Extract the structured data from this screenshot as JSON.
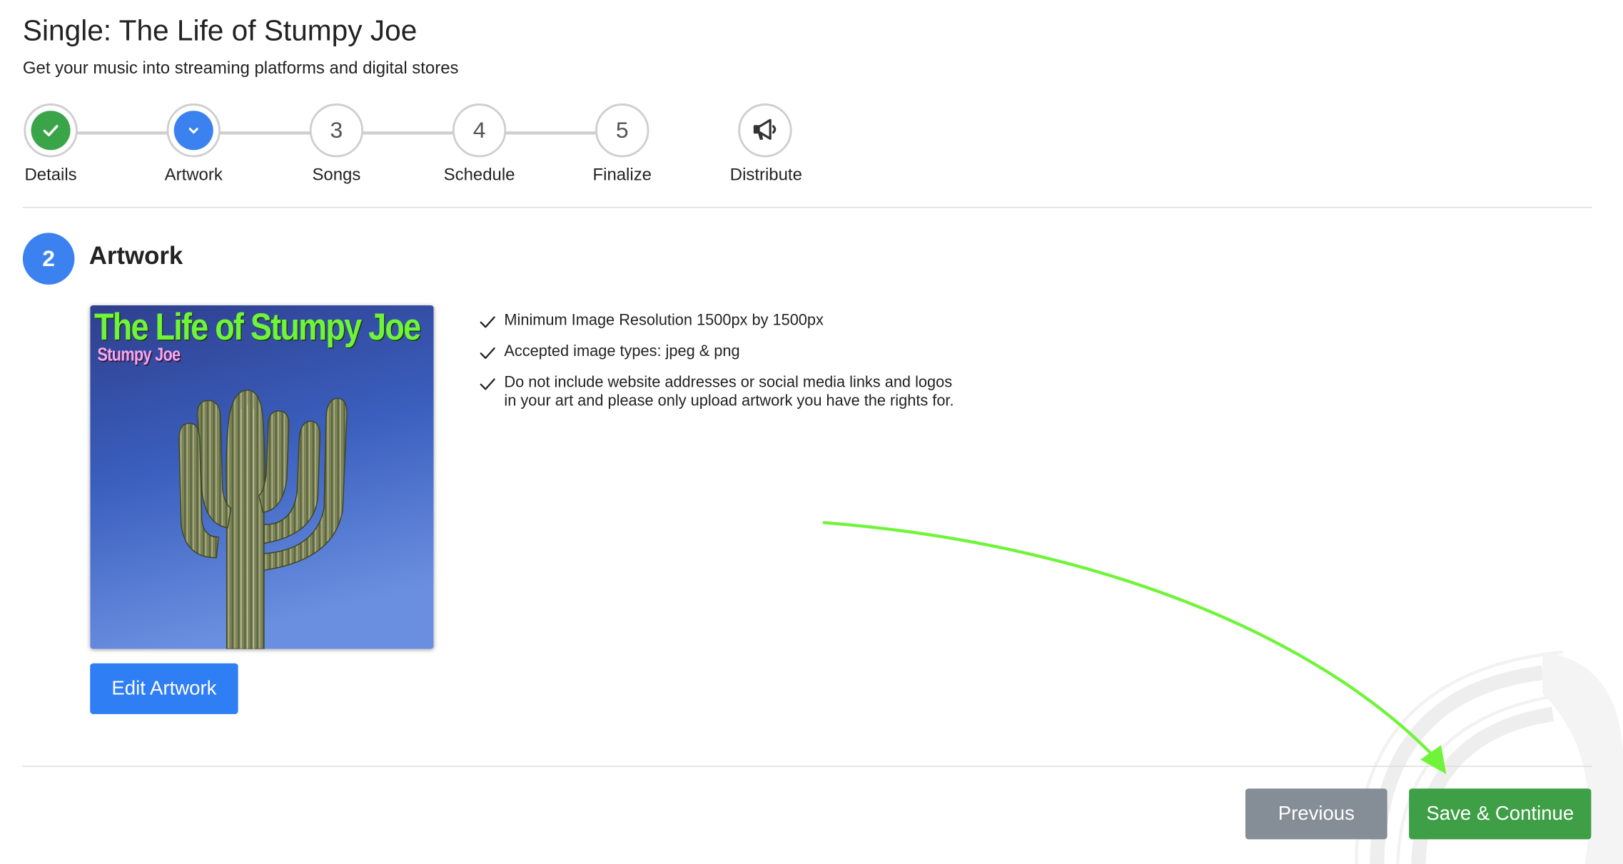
{
  "header": {
    "title": "Single: The Life of Stumpy Joe",
    "subtitle": "Get your music into streaming platforms and digital stores"
  },
  "stepper": {
    "steps": [
      {
        "label": "Details",
        "number": "",
        "state": "completed",
        "icon": "check-icon"
      },
      {
        "label": "Artwork",
        "number": "",
        "state": "active",
        "icon": "chevron-down-icon"
      },
      {
        "label": "Songs",
        "number": "3",
        "state": "pending"
      },
      {
        "label": "Schedule",
        "number": "4",
        "state": "pending"
      },
      {
        "label": "Finalize",
        "number": "5",
        "state": "pending"
      },
      {
        "label": "Distribute",
        "number": "",
        "state": "pending",
        "icon": "megaphone-icon"
      }
    ]
  },
  "section": {
    "number": "2",
    "title": "Artwork"
  },
  "artwork": {
    "title_text": "The Life of Stumpy Joe",
    "artist_text": "Stumpy Joe",
    "edit_button": "Edit Artwork"
  },
  "requirements": [
    "Minimum Image Resolution 1500px by 1500px",
    "Accepted image types: jpeg & png",
    "Do not include website addresses or social media links and logos in your art and please only upload artwork you have the rights for."
  ],
  "footer": {
    "previous_button": "Previous",
    "save_button": "Save & Continue"
  },
  "colors": {
    "primary_blue": "#3b82f0",
    "success_green": "#3aa548",
    "secondary_gray": "#858d97",
    "annotation_arrow": "#6ff43a"
  }
}
